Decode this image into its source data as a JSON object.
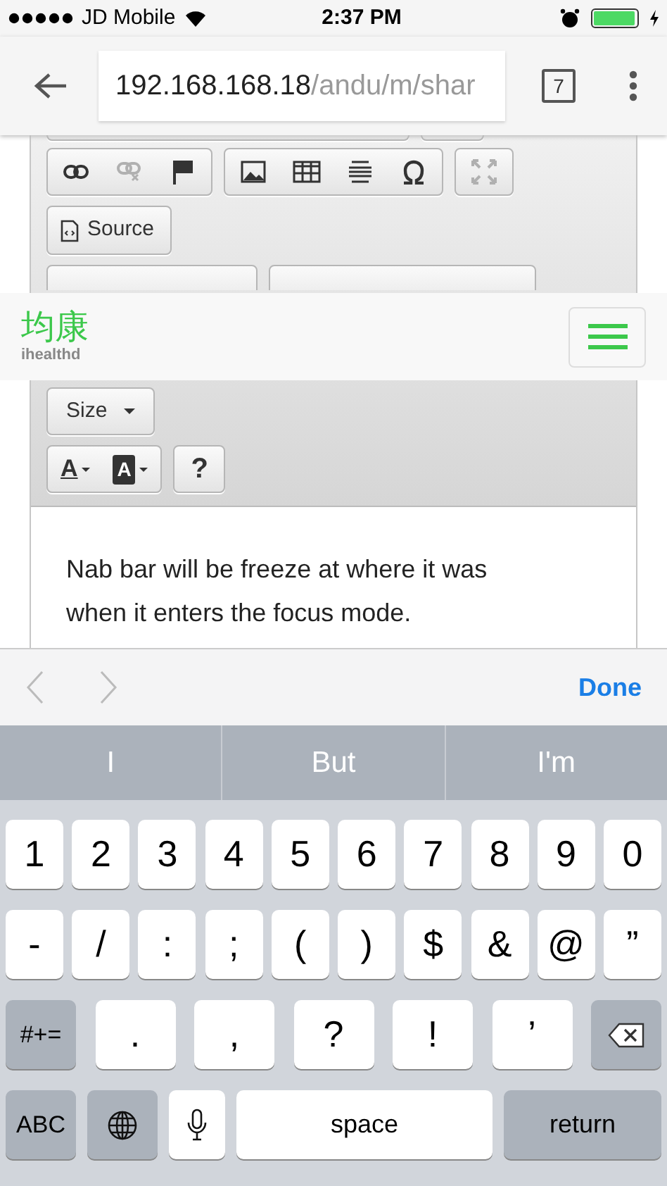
{
  "status_bar": {
    "carrier": "JD Mobile",
    "time": "2:37 PM",
    "battery": {
      "level": 0.95
    }
  },
  "browser": {
    "url_host": "192.168.168.18",
    "url_path": "/andu/m/shar",
    "tab_count": "7"
  },
  "editor": {
    "toolbar_rows": [
      {
        "groups": [
          {
            "items": [
              {
                "kind": "link",
                "disabled": false
              },
              {
                "kind": "unlink",
                "disabled": true
              },
              {
                "kind": "flag",
                "disabled": false
              }
            ]
          },
          {
            "items": [
              {
                "kind": "image",
                "disabled": false
              },
              {
                "kind": "table",
                "disabled": false
              },
              {
                "kind": "rule",
                "disabled": false
              },
              {
                "kind": "omega",
                "disabled": false
              }
            ]
          },
          {
            "items": [
              {
                "kind": "maximize",
                "disabled": true
              }
            ]
          }
        ]
      }
    ],
    "source_button": "Source",
    "size_dropdown": "Size",
    "help_button": "?",
    "text_color_letter": "A",
    "background_color_letter": "A",
    "body": "Nab bar will be freeze at where it was when it enters the focus mode."
  },
  "site_nav": {
    "logo": "均康",
    "logo_sub": "ihealthd"
  },
  "keyboard_toolbar": {
    "done": "Done"
  },
  "suggestions": [
    "I",
    "But",
    "I'm"
  ],
  "keyboard": {
    "key_rows": [
      {
        "keys": [
          "1",
          "2",
          "3",
          "4",
          "5",
          "6",
          "7",
          "8",
          "9",
          "0"
        ]
      },
      {
        "keys": [
          "-",
          "/",
          ":",
          ";",
          "(",
          ")",
          "$",
          "&",
          "@",
          "”"
        ]
      },
      {
        "keys": [
          {
            "kind": "mode",
            "label": "#+="
          },
          {
            "kind": "char",
            "label": "."
          },
          {
            "kind": "char",
            "label": ","
          },
          {
            "kind": "char",
            "label": "?"
          },
          {
            "kind": "char",
            "label": "!"
          },
          {
            "kind": "char",
            "label": "’"
          },
          {
            "kind": "backspace"
          }
        ]
      },
      {
        "keys": [
          {
            "kind": "mode",
            "label": "ABC"
          },
          {
            "kind": "globe"
          },
          {
            "kind": "mic"
          },
          {
            "kind": "space",
            "label": "space"
          },
          {
            "kind": "return",
            "label": "return"
          }
        ]
      }
    ]
  }
}
